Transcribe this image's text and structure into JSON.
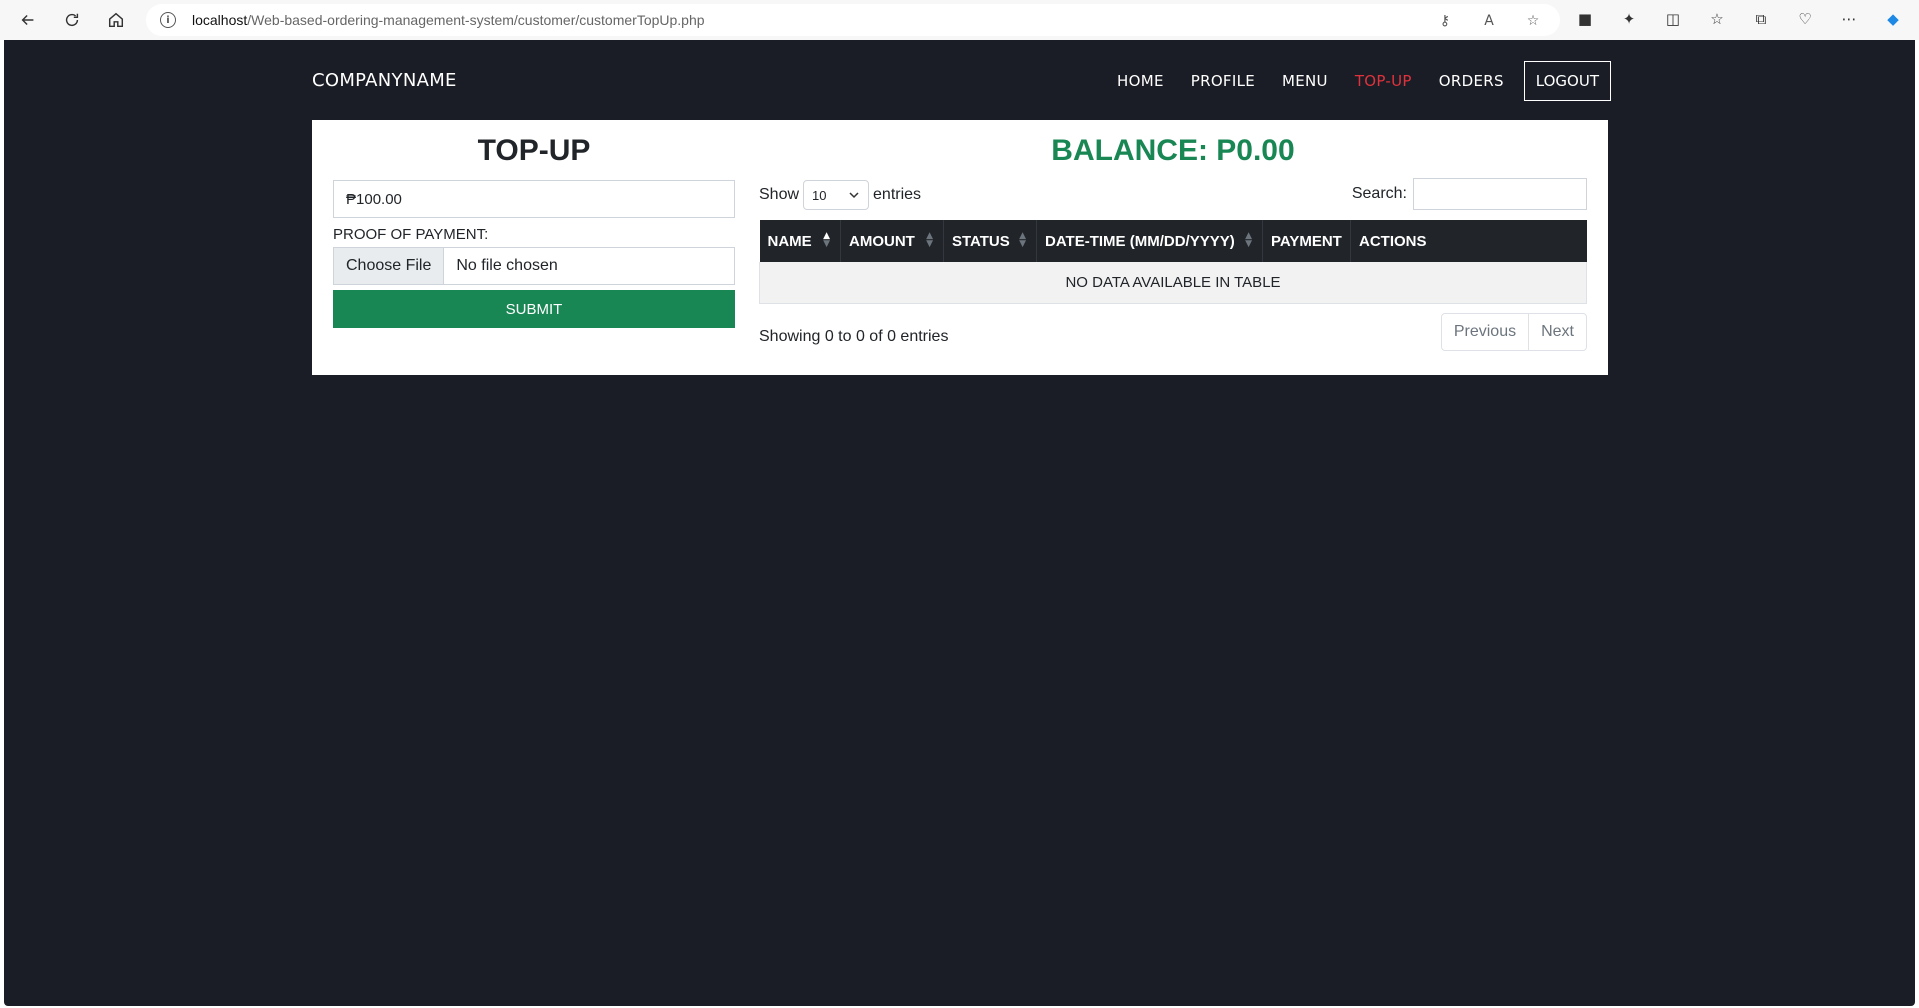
{
  "browser": {
    "url_host": "localhost",
    "url_path": "/Web-based-ordering-management-system/customer/customerTopUp.php"
  },
  "navbar": {
    "brand": "COMPANYNAME",
    "items": [
      {
        "label": "HOME",
        "active": false
      },
      {
        "label": "PROFILE",
        "active": false
      },
      {
        "label": "MENU",
        "active": false
      },
      {
        "label": "TOP-UP",
        "active": true
      },
      {
        "label": "ORDERS",
        "active": false
      }
    ],
    "logout_label": "LOGOUT",
    "active_color": "#e0323c"
  },
  "topup_form": {
    "title": "TOP-UP",
    "amount_value": "₱100.00",
    "proof_label": "PROOF OF PAYMENT:",
    "file_button_label": "Choose File",
    "file_status": "No file chosen",
    "submit_label": "SUBMIT",
    "submit_color": "#198754"
  },
  "balance": {
    "text": "BALANCE: P0.00",
    "color": "#198754"
  },
  "table": {
    "show_label": "Show",
    "page_length": "10",
    "entries_label": "entries",
    "search_label": "Search:",
    "search_value": "",
    "columns": [
      {
        "label": "NAME",
        "sortable": true,
        "sorted": "asc"
      },
      {
        "label": "AMOUNT",
        "sortable": true,
        "sorted": "none"
      },
      {
        "label": "STATUS",
        "sortable": true,
        "sorted": "none"
      },
      {
        "label": "DATE-TIME (MM/DD/YYYY)",
        "sortable": true,
        "sorted": "none"
      },
      {
        "label": "PAYMENT",
        "sortable": false,
        "sorted": "none"
      },
      {
        "label": "ACTIONS",
        "sortable": false,
        "sorted": "none"
      }
    ],
    "empty_message": "NO DATA AVAILABLE IN TABLE",
    "info": "Showing 0 to 0 of 0 entries",
    "previous_label": "Previous",
    "next_label": "Next"
  },
  "colors": {
    "page_background": "#1a1d25",
    "table_header": "#212529"
  }
}
